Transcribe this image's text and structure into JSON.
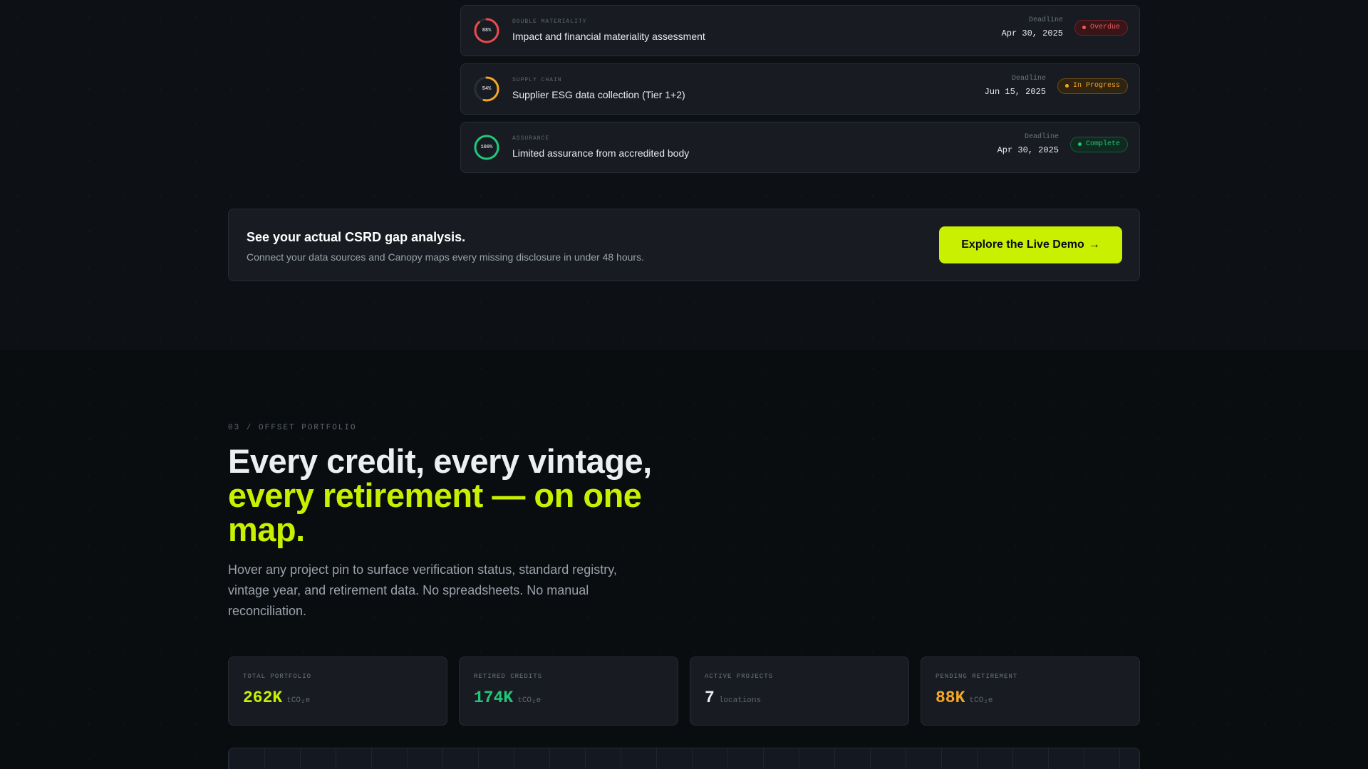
{
  "tasks": [
    {
      "category": "DOUBLE MATERIALITY",
      "title": "Impact and financial materiality assessment",
      "progress_label": "88%",
      "progress": 0.88,
      "ring_color": "#ef4a4a",
      "deadline_label": "Deadline",
      "deadline": "Apr 30, 2025",
      "status": "Overdue",
      "status_kind": "overdue"
    },
    {
      "category": "SUPPLY CHAIN",
      "title": "Supplier ESG data collection (Tier 1+2)",
      "progress_label": "54%",
      "progress": 0.54,
      "ring_color": "#f5a623",
      "deadline_label": "Deadline",
      "deadline": "Jun 15, 2025",
      "status": "In Progress",
      "status_kind": "progress"
    },
    {
      "category": "ASSURANCE",
      "title": "Limited assurance from accredited body",
      "progress_label": "100%",
      "progress": 1.0,
      "ring_color": "#22c77a",
      "deadline_label": "Deadline",
      "deadline": "Apr 30, 2025",
      "status": "Complete",
      "status_kind": "complete"
    }
  ],
  "cta": {
    "title": "See your actual CSRD gap analysis.",
    "subtitle": "Connect your data sources and Canopy maps every missing disclosure in under 48 hours.",
    "button_label": "Explore the Live Demo",
    "button_arrow": "→"
  },
  "section": {
    "eyebrow": "03 / OFFSET PORTFOLIO",
    "headline_line1": "Every credit, every vintage,",
    "headline_accent": "every retirement — on one map.",
    "lede": "Hover any project pin to surface verification status, standard registry, vintage year, and retirement data. No spreadsheets. No manual reconciliation."
  },
  "stats": [
    {
      "label": "TOTAL PORTFOLIO",
      "value": "262K",
      "unit": "tCO₂e",
      "color": "#c8f000"
    },
    {
      "label": "RETIRED CREDITS",
      "value": "174K",
      "unit": "tCO₂e",
      "color": "#22c77a"
    },
    {
      "label": "ACTIVE PROJECTS",
      "value": "7",
      "unit": "locations",
      "color": "#eceef0"
    },
    {
      "label": "PENDING RETIREMENT",
      "value": "88K",
      "unit": "tCO₂e",
      "color": "#f5a623"
    }
  ]
}
